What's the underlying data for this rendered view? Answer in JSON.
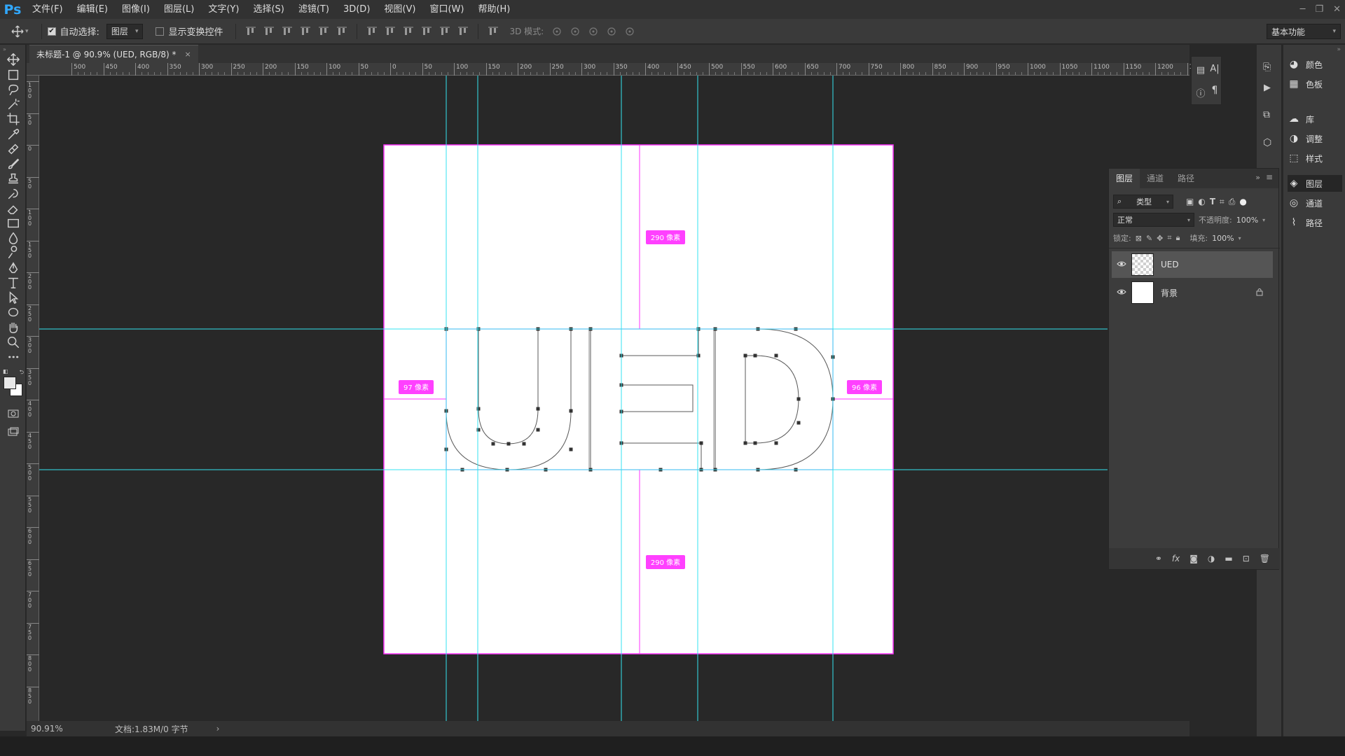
{
  "app": {
    "logo": "Ps"
  },
  "menu": [
    "文件(F)",
    "编辑(E)",
    "图像(I)",
    "图层(L)",
    "文字(Y)",
    "选择(S)",
    "滤镜(T)",
    "3D(D)",
    "视图(V)",
    "窗口(W)",
    "帮助(H)"
  ],
  "options": {
    "auto_select_label": "自动选择:",
    "auto_select_checked": true,
    "auto_select_value": "图层",
    "show_transform_label": "显示变换控件",
    "mode3d_label": "3D 模式:",
    "workspace": "基本功能"
  },
  "document": {
    "tab_title": "未标题-1 @ 90.9% (UED, RGB/8) *",
    "zoom": "90.91%",
    "doc_info": "文档:1.83M/0 字节"
  },
  "ruler_h_labels": [
    "500",
    "450",
    "400",
    "350",
    "300",
    "250",
    "200",
    "150",
    "100",
    "50",
    "0",
    "50",
    "100",
    "150",
    "200",
    "250",
    "300",
    "350",
    "400",
    "450",
    "500",
    "550",
    "600",
    "650",
    "700",
    "750",
    "800",
    "850",
    "900",
    "950",
    "1000",
    "1050",
    "1100",
    "1150",
    "1200",
    "125"
  ],
  "ruler_v_labels": [
    "100",
    "50",
    "0",
    "50",
    "100",
    "150",
    "200",
    "250",
    "300",
    "350",
    "400",
    "450",
    "500",
    "550",
    "600",
    "650",
    "700",
    "750",
    "800",
    "850"
  ],
  "measurements": {
    "top": "290 像素",
    "bottom": "290 像素",
    "left": "97 像素",
    "right": "96 像素"
  },
  "dock": {
    "items": [
      {
        "label": "颜色",
        "icon": "color-icon"
      },
      {
        "label": "色板",
        "icon": "swatches-icon"
      },
      {
        "label": "库",
        "icon": "libraries-icon"
      },
      {
        "label": "调整",
        "icon": "adjustments-icon"
      },
      {
        "label": "样式",
        "icon": "styles-icon"
      },
      {
        "label": "图层",
        "icon": "layers-icon"
      },
      {
        "label": "通道",
        "icon": "channels-icon"
      },
      {
        "label": "路径",
        "icon": "paths-icon"
      }
    ]
  },
  "layers_panel": {
    "tabs": [
      "图层",
      "通道",
      "路径"
    ],
    "filter_label": "类型",
    "blend_mode": "正常",
    "opacity_label": "不透明度:",
    "opacity_value": "100%",
    "lock_label": "锁定:",
    "fill_label": "填充:",
    "fill_value": "100%",
    "layers": [
      {
        "name": "UED",
        "selected": true,
        "locked": false
      },
      {
        "name": "背景",
        "selected": false,
        "locked": true
      }
    ]
  },
  "colors": {
    "guide": "#33e3f0",
    "selection": "#ff33ff",
    "measure_badge": "#ff40ff",
    "path": "#555555"
  }
}
